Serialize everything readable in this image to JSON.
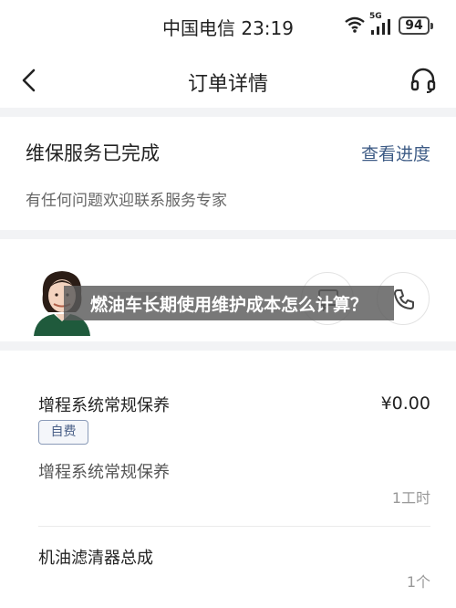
{
  "status_bar": {
    "carrier_time": "中国电信 23:19",
    "network_label": "5G",
    "battery": "94"
  },
  "nav": {
    "title": "订单详情",
    "back_icon": "chevron-left-icon",
    "service_icon": "headset-icon"
  },
  "order_status": {
    "title": "维保服务已完成",
    "progress_link": "查看进度",
    "subtitle": "有任何问题欢迎联系服务专家"
  },
  "advisor": {
    "avatar_icon": "advisor-avatar",
    "chat_icon": "chat-icon",
    "call_icon": "phone-icon"
  },
  "overlay": {
    "text": "燃油车长期使用维护成本怎么计算？"
  },
  "service": {
    "items": [
      {
        "name": "增程系统常规保养",
        "price": "¥0.00",
        "tag": "自费",
        "description": "增程系统常规保养",
        "quantity": "1工时"
      },
      {
        "name": "机油滤清器总成",
        "quantity": "1个"
      }
    ]
  },
  "colors": {
    "accent_link": "#3d5b85",
    "background": "#f2f3f5",
    "tag_border": "#8a9bb8"
  }
}
